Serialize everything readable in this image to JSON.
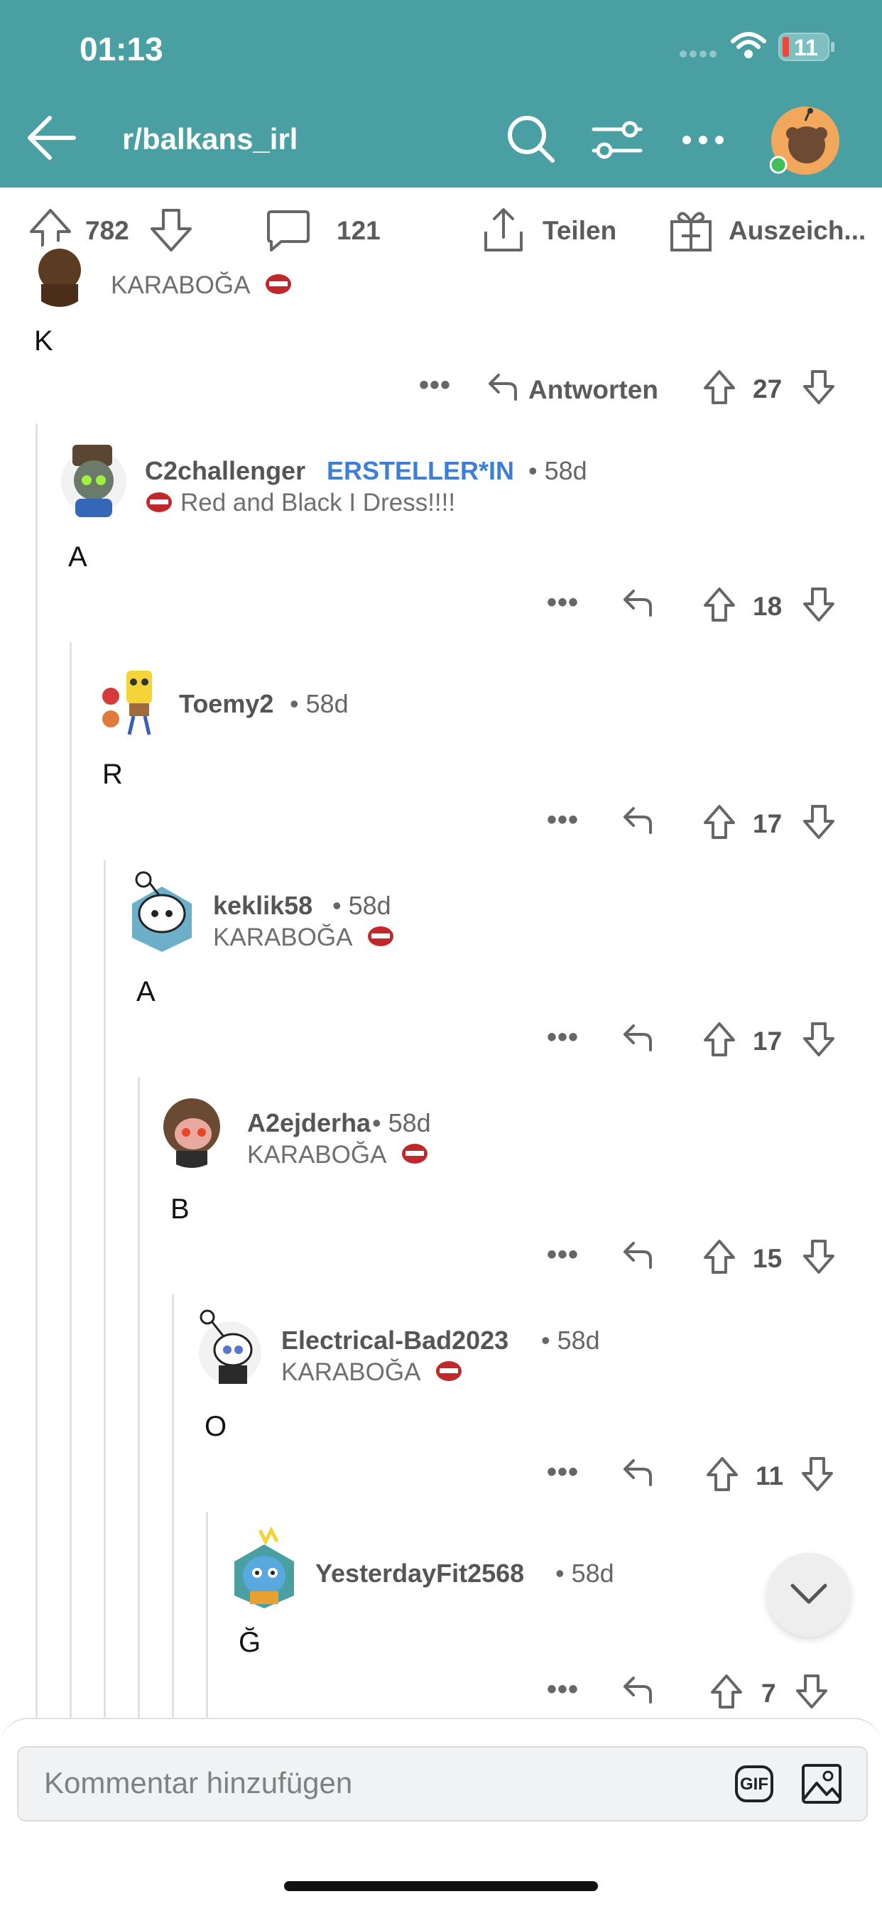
{
  "status": {
    "time": "01:13",
    "battery": "11"
  },
  "nav": {
    "title": "r/balkans_irl"
  },
  "actions": {
    "upvotes": "782",
    "comments": "121",
    "share": "Teilen",
    "award": "Auszeich..."
  },
  "top_comment": {
    "flair": "KARABOĞA",
    "text": "K",
    "reply": "Antworten",
    "votes": "27"
  },
  "comments": [
    {
      "user": "C2challenger",
      "op_badge": "ERSTELLER*IN",
      "age": "58d",
      "flair": "Red and Black I Dress!!!!",
      "text": "A",
      "votes": "18"
    },
    {
      "user": "Toemy2",
      "age": "58d",
      "flair": "",
      "text": "R",
      "votes": "17"
    },
    {
      "user": "keklik58",
      "age": "58d",
      "flair": "KARABOĞA",
      "text": "A",
      "votes": "17"
    },
    {
      "user": "A2ejderha",
      "age": "58d",
      "flair": "KARABOĞA",
      "text": "B",
      "votes": "15"
    },
    {
      "user": "Electrical-Bad2023",
      "age": "58d",
      "flair": "KARABOĞA",
      "text": "O",
      "votes": "11"
    },
    {
      "user": "YesterdayFit2568",
      "age": "58d",
      "flair": "",
      "text": "Ğ",
      "votes": "7"
    }
  ],
  "composer": {
    "placeholder": "Kommentar hinzufügen",
    "gif_label": "GIF"
  },
  "colors": {
    "header": "#4a9fa2",
    "op_badge": "#3d7fd6",
    "battery_low": "#e84a3d"
  }
}
